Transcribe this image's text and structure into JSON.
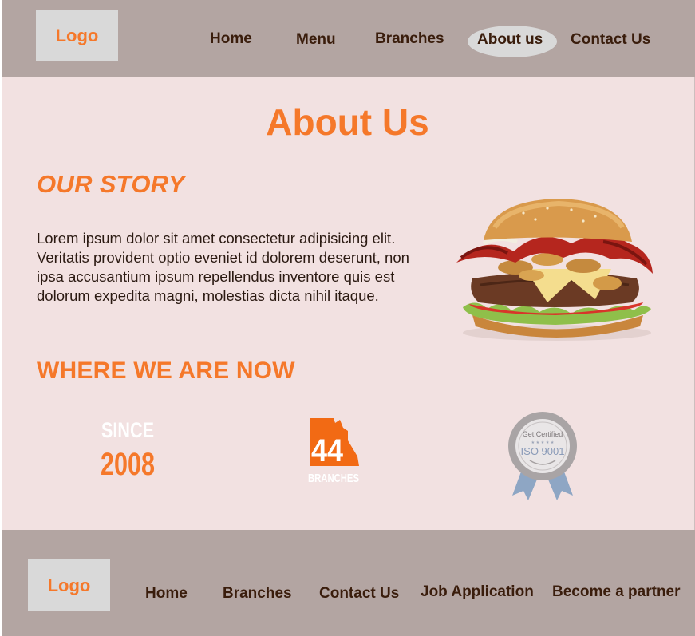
{
  "header": {
    "logo": "Logo",
    "nav": [
      "Home",
      "Menu",
      "Branches",
      "About us",
      "Contact Us"
    ],
    "active": "About us"
  },
  "main": {
    "title": "About Us",
    "story_heading": "OUR STORY",
    "story_text": "Lorem ipsum dolor sit amet consectetur adipisicing elit. Veritatis provident optio eveniet id dolorem deserunt, non ipsa accusantium ipsum repellendus inventore quis est dolorum expedita magni, molestias dicta nihil itaque.",
    "where_heading": "WHERE WE ARE NOW",
    "badges": {
      "since_label": "SINCE",
      "since_year": "2008",
      "branches_count": "44",
      "branches_label": "BRANCHES",
      "iso_top": "Get Certified",
      "iso_stars": "★ ★ ★ ★ ★",
      "iso_label": "ISO 9001"
    }
  },
  "footer": {
    "logo": "Logo",
    "nav": [
      "Home",
      "Branches",
      "Contact Us",
      "Job Application",
      "Become a partner"
    ]
  },
  "colors": {
    "accent": "#f5782a",
    "bar": "#b3a5a2",
    "page_bg": "#f2e1e1",
    "nav_text": "#3a1d0c"
  }
}
